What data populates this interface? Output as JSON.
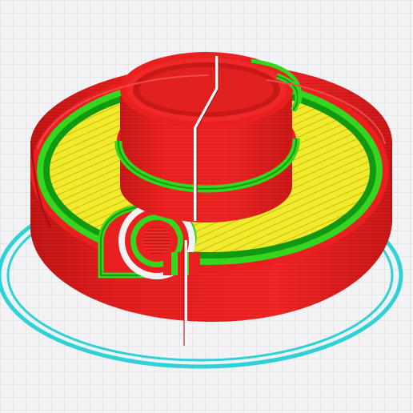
{
  "viewer": {
    "label": ""
  },
  "colors": {
    "background": "#f3f3f5",
    "grid_line": "#d7d8de",
    "outer_wall": "#ea1f1f",
    "wall_dark": "#b51212",
    "inner_wall": "#35d61f",
    "infill": "#f2ea2c",
    "skirt": "#2fd0d6",
    "seam": "#ffffff"
  },
  "objects": [
    {
      "name": "printed-part"
    },
    {
      "name": "skirt-outline"
    }
  ]
}
